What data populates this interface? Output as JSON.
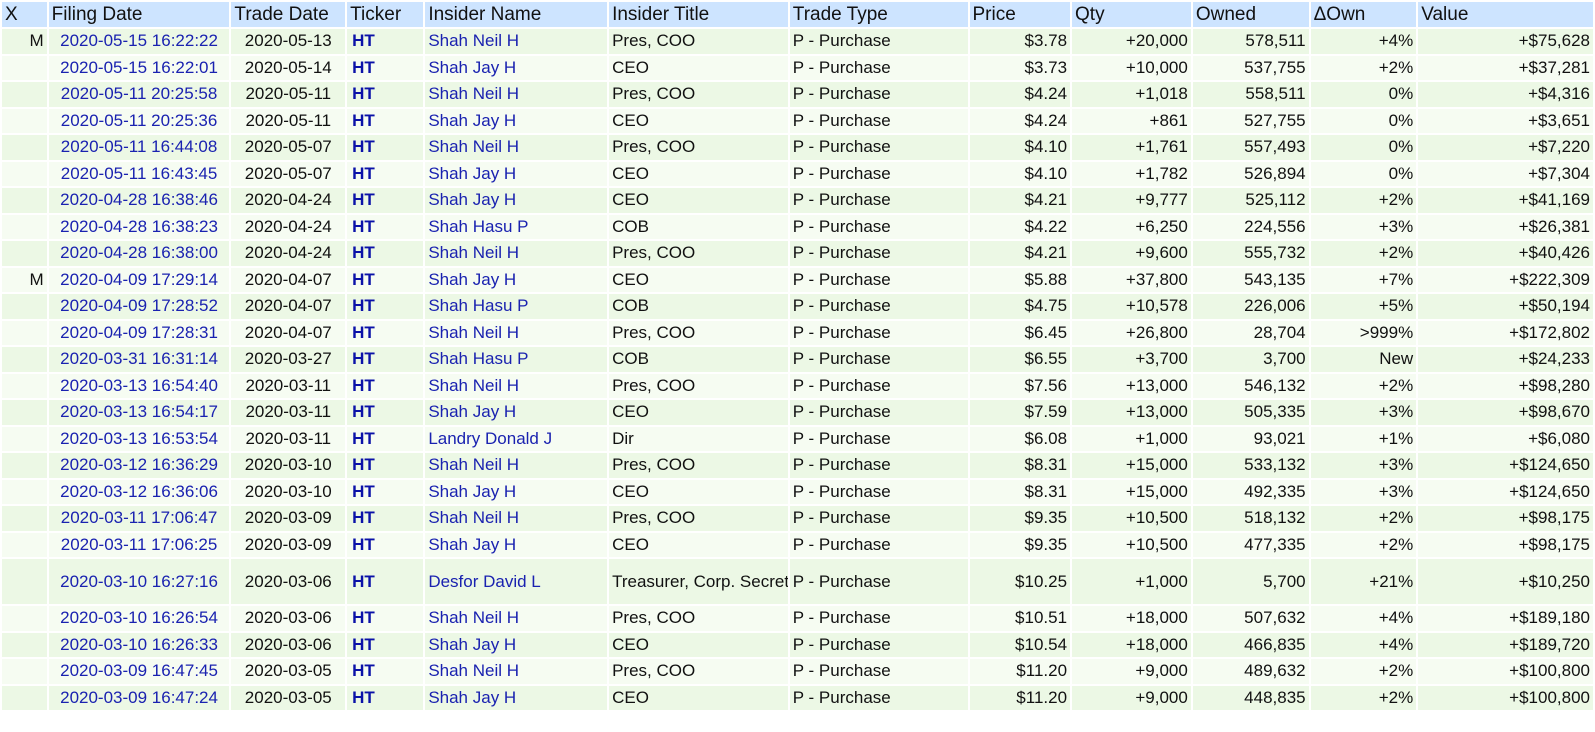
{
  "headers": [
    "X",
    "Filing Date",
    "Trade Date",
    "Ticker",
    "Insider Name",
    "Insider Title",
    "Trade Type",
    "Price",
    "Qty",
    "Owned",
    "ΔOwn",
    "Value"
  ],
  "rows": [
    {
      "x": "M",
      "filing": "2020-05-15 16:22:22",
      "trade": "2020-05-13",
      "ticker": "HT",
      "name": "Shah Neil H",
      "title": "Pres, COO",
      "type": "P - Purchase",
      "price": "$3.78",
      "qty": "+20,000",
      "owned": "578,511",
      "own": "+4%",
      "value": "+$75,628"
    },
    {
      "x": "",
      "filing": "2020-05-15 16:22:01",
      "trade": "2020-05-14",
      "ticker": "HT",
      "name": "Shah Jay H",
      "title": "CEO",
      "type": "P - Purchase",
      "price": "$3.73",
      "qty": "+10,000",
      "owned": "537,755",
      "own": "+2%",
      "value": "+$37,281"
    },
    {
      "x": "",
      "filing": "2020-05-11 20:25:58",
      "trade": "2020-05-11",
      "ticker": "HT",
      "name": "Shah Neil H",
      "title": "Pres, COO",
      "type": "P - Purchase",
      "price": "$4.24",
      "qty": "+1,018",
      "owned": "558,511",
      "own": "0%",
      "value": "+$4,316"
    },
    {
      "x": "",
      "filing": "2020-05-11 20:25:36",
      "trade": "2020-05-11",
      "ticker": "HT",
      "name": "Shah Jay H",
      "title": "CEO",
      "type": "P - Purchase",
      "price": "$4.24",
      "qty": "+861",
      "owned": "527,755",
      "own": "0%",
      "value": "+$3,651"
    },
    {
      "x": "",
      "filing": "2020-05-11 16:44:08",
      "trade": "2020-05-07",
      "ticker": "HT",
      "name": "Shah Neil H",
      "title": "Pres, COO",
      "type": "P - Purchase",
      "price": "$4.10",
      "qty": "+1,761",
      "owned": "557,493",
      "own": "0%",
      "value": "+$7,220"
    },
    {
      "x": "",
      "filing": "2020-05-11 16:43:45",
      "trade": "2020-05-07",
      "ticker": "HT",
      "name": "Shah Jay H",
      "title": "CEO",
      "type": "P - Purchase",
      "price": "$4.10",
      "qty": "+1,782",
      "owned": "526,894",
      "own": "0%",
      "value": "+$7,304"
    },
    {
      "x": "",
      "filing": "2020-04-28 16:38:46",
      "trade": "2020-04-24",
      "ticker": "HT",
      "name": "Shah Jay H",
      "title": "CEO",
      "type": "P - Purchase",
      "price": "$4.21",
      "qty": "+9,777",
      "owned": "525,112",
      "own": "+2%",
      "value": "+$41,169"
    },
    {
      "x": "",
      "filing": "2020-04-28 16:38:23",
      "trade": "2020-04-24",
      "ticker": "HT",
      "name": "Shah Hasu P",
      "title": "COB",
      "type": "P - Purchase",
      "price": "$4.22",
      "qty": "+6,250",
      "owned": "224,556",
      "own": "+3%",
      "value": "+$26,381"
    },
    {
      "x": "",
      "filing": "2020-04-28 16:38:00",
      "trade": "2020-04-24",
      "ticker": "HT",
      "name": "Shah Neil H",
      "title": "Pres, COO",
      "type": "P - Purchase",
      "price": "$4.21",
      "qty": "+9,600",
      "owned": "555,732",
      "own": "+2%",
      "value": "+$40,426"
    },
    {
      "x": "M",
      "filing": "2020-04-09 17:29:14",
      "trade": "2020-04-07",
      "ticker": "HT",
      "name": "Shah Jay H",
      "title": "CEO",
      "type": "P - Purchase",
      "price": "$5.88",
      "qty": "+37,800",
      "owned": "543,135",
      "own": "+7%",
      "value": "+$222,309"
    },
    {
      "x": "",
      "filing": "2020-04-09 17:28:52",
      "trade": "2020-04-07",
      "ticker": "HT",
      "name": "Shah Hasu P",
      "title": "COB",
      "type": "P - Purchase",
      "price": "$4.75",
      "qty": "+10,578",
      "owned": "226,006",
      "own": "+5%",
      "value": "+$50,194"
    },
    {
      "x": "",
      "filing": "2020-04-09 17:28:31",
      "trade": "2020-04-07",
      "ticker": "HT",
      "name": "Shah Neil H",
      "title": "Pres, COO",
      "type": "P - Purchase",
      "price": "$6.45",
      "qty": "+26,800",
      "owned": "28,704",
      "own": ">999%",
      "value": "+$172,802"
    },
    {
      "x": "",
      "filing": "2020-03-31 16:31:14",
      "trade": "2020-03-27",
      "ticker": "HT",
      "name": "Shah Hasu P",
      "title": "COB",
      "type": "P - Purchase",
      "price": "$6.55",
      "qty": "+3,700",
      "owned": "3,700",
      "own": "New",
      "value": "+$24,233"
    },
    {
      "x": "",
      "filing": "2020-03-13 16:54:40",
      "trade": "2020-03-11",
      "ticker": "HT",
      "name": "Shah Neil H",
      "title": "Pres, COO",
      "type": "P - Purchase",
      "price": "$7.56",
      "qty": "+13,000",
      "owned": "546,132",
      "own": "+2%",
      "value": "+$98,280"
    },
    {
      "x": "",
      "filing": "2020-03-13 16:54:17",
      "trade": "2020-03-11",
      "ticker": "HT",
      "name": "Shah Jay H",
      "title": "CEO",
      "type": "P - Purchase",
      "price": "$7.59",
      "qty": "+13,000",
      "owned": "505,335",
      "own": "+3%",
      "value": "+$98,670"
    },
    {
      "x": "",
      "filing": "2020-03-13 16:53:54",
      "trade": "2020-03-11",
      "ticker": "HT",
      "name": "Landry Donald J",
      "title": "Dir",
      "type": "P - Purchase",
      "price": "$6.08",
      "qty": "+1,000",
      "owned": "93,021",
      "own": "+1%",
      "value": "+$6,080"
    },
    {
      "x": "",
      "filing": "2020-03-12 16:36:29",
      "trade": "2020-03-10",
      "ticker": "HT",
      "name": "Shah Neil H",
      "title": "Pres, COO",
      "type": "P - Purchase",
      "price": "$8.31",
      "qty": "+15,000",
      "owned": "533,132",
      "own": "+3%",
      "value": "+$124,650"
    },
    {
      "x": "",
      "filing": "2020-03-12 16:36:06",
      "trade": "2020-03-10",
      "ticker": "HT",
      "name": "Shah Jay H",
      "title": "CEO",
      "type": "P - Purchase",
      "price": "$8.31",
      "qty": "+15,000",
      "owned": "492,335",
      "own": "+3%",
      "value": "+$124,650"
    },
    {
      "x": "",
      "filing": "2020-03-11 17:06:47",
      "trade": "2020-03-09",
      "ticker": "HT",
      "name": "Shah Neil H",
      "title": "Pres, COO",
      "type": "P - Purchase",
      "price": "$9.35",
      "qty": "+10,500",
      "owned": "518,132",
      "own": "+2%",
      "value": "+$98,175"
    },
    {
      "x": "",
      "filing": "2020-03-11 17:06:25",
      "trade": "2020-03-09",
      "ticker": "HT",
      "name": "Shah Jay H",
      "title": "CEO",
      "type": "P - Purchase",
      "price": "$9.35",
      "qty": "+10,500",
      "owned": "477,335",
      "own": "+2%",
      "value": "+$98,175"
    },
    {
      "x": "",
      "filing": "2020-03-10 16:27:16",
      "trade": "2020-03-06",
      "ticker": "HT",
      "name": "Desfor David L",
      "title": "Treasurer, Corp. Secretary",
      "type": "P - Purchase",
      "price": "$10.25",
      "qty": "+1,000",
      "owned": "5,700",
      "own": "+21%",
      "value": "+$10,250"
    },
    {
      "x": "",
      "filing": "2020-03-10 16:26:54",
      "trade": "2020-03-06",
      "ticker": "HT",
      "name": "Shah Neil H",
      "title": "Pres, COO",
      "type": "P - Purchase",
      "price": "$10.51",
      "qty": "+18,000",
      "owned": "507,632",
      "own": "+4%",
      "value": "+$189,180"
    },
    {
      "x": "",
      "filing": "2020-03-10 16:26:33",
      "trade": "2020-03-06",
      "ticker": "HT",
      "name": "Shah Jay H",
      "title": "CEO",
      "type": "P - Purchase",
      "price": "$10.54",
      "qty": "+18,000",
      "owned": "466,835",
      "own": "+4%",
      "value": "+$189,720"
    },
    {
      "x": "",
      "filing": "2020-03-09 16:47:45",
      "trade": "2020-03-05",
      "ticker": "HT",
      "name": "Shah Neil H",
      "title": "Pres, COO",
      "type": "P - Purchase",
      "price": "$11.20",
      "qty": "+9,000",
      "owned": "489,632",
      "own": "+2%",
      "value": "+$100,800"
    },
    {
      "x": "",
      "filing": "2020-03-09 16:47:24",
      "trade": "2020-03-05",
      "ticker": "HT",
      "name": "Shah Jay H",
      "title": "CEO",
      "type": "P - Purchase",
      "price": "$11.20",
      "qty": "+9,000",
      "owned": "448,835",
      "own": "+2%",
      "value": "+$100,800"
    }
  ]
}
